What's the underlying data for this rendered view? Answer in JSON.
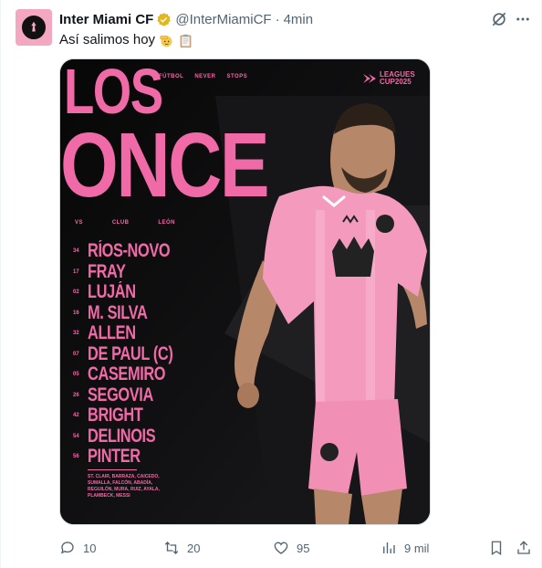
{
  "tweet": {
    "display_name": "Inter Miami CF",
    "handle": "@InterMiamiCF",
    "separator": "·",
    "time": "4min",
    "text": "Así salimos hoy",
    "avatar_icon": "heron-crest-icon",
    "verified_color": "#e2b719",
    "media": {
      "title_line1": "LOS",
      "title_line2": "ONCE",
      "tags": [
        "FÚTBOL",
        "NEVER",
        "STOPS"
      ],
      "logo_line1": "LEAGUES",
      "logo_line2": "CUP2025",
      "vs_row": [
        "VS",
        "CLUB",
        "LEÓN"
      ],
      "accent_color": "#f06aa8",
      "lineup": [
        {
          "number": "34",
          "name": "RÍOS-NOVO"
        },
        {
          "number": "17",
          "name": "FRAY"
        },
        {
          "number": "02",
          "name": "LUJÁN"
        },
        {
          "number": "16",
          "name": "M. SILVA"
        },
        {
          "number": "32",
          "name": "ALLEN"
        },
        {
          "number": "07",
          "name": "DE PAUL (C)"
        },
        {
          "number": "05",
          "name": "CASEMIRO"
        },
        {
          "number": "26",
          "name": "SEGOVIA"
        },
        {
          "number": "42",
          "name": "BRIGHT"
        },
        {
          "number": "54",
          "name": "DELINOIS"
        },
        {
          "number": "56",
          "name": "PINTER"
        }
      ],
      "substitutes": "ST. CLAIR, BARRAZA, CAICEDO, SUMALLA, FALCÓN, ABADÍA, REGUILÓN, MURA, RUIZ, AYALA, PLAMBECK, MESSI"
    },
    "actions": {
      "replies": "10",
      "retweets": "20",
      "likes": "95",
      "views": "9 mil"
    }
  }
}
